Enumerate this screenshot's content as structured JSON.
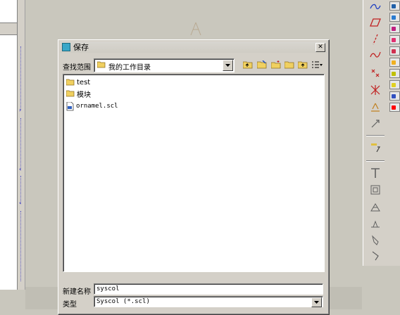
{
  "dialog": {
    "title": "保存",
    "look_in_label": "查找范围",
    "look_in_value": "我的工作目录",
    "files": [
      {
        "name": "test",
        "type": "folder"
      },
      {
        "name": "模块",
        "type": "folder"
      },
      {
        "name": "ornamel.scl",
        "type": "file"
      }
    ],
    "filename_label": "新建名称",
    "filename_value": "syscol",
    "type_label": "类型",
    "type_value": "Syscol (*.scl)"
  },
  "palette_colors": [
    "#1f5fa8",
    "#2a7bd0",
    "#c02080",
    "#e03070",
    "#d03050",
    "#f0b020",
    "#c0c000",
    "#e0d020",
    "#3050c0",
    "#ff0000"
  ],
  "toolbar_icons": [
    "curve-icon",
    "parallelogram-icon",
    "line-icon",
    "spline-icon",
    "point-icon",
    "trim-icon",
    "dimension-icon",
    "link-icon",
    "note-icon",
    "text-icon",
    "frame-icon",
    "symbol-icon",
    "weld-icon",
    "pen-icon",
    "flag-icon"
  ]
}
